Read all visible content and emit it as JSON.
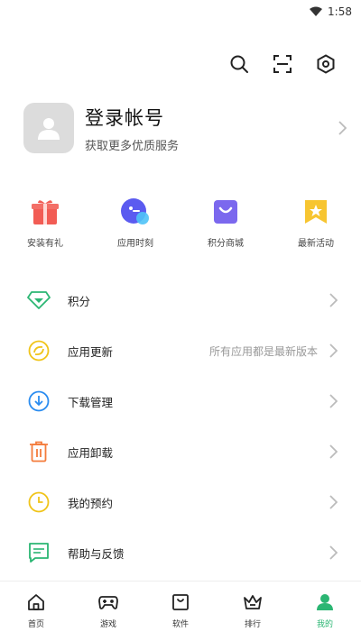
{
  "status": {
    "time": "1:58"
  },
  "top_actions": [
    "search-icon",
    "scan-icon",
    "settings-icon"
  ],
  "profile": {
    "title": "登录帐号",
    "subtitle": "获取更多优质服务"
  },
  "quick_actions": [
    {
      "label": "安装有礼",
      "icon": "gift-icon",
      "color": "#f25c54"
    },
    {
      "label": "应用时刻",
      "icon": "app-moment-icon",
      "color": "#5b5bf0"
    },
    {
      "label": "积分商城",
      "icon": "points-mall-icon",
      "color": "#7b68ee"
    },
    {
      "label": "最新活动",
      "icon": "latest-activity-icon",
      "color": "#f7c531"
    }
  ],
  "menu": [
    {
      "label": "积分",
      "icon": "diamond-icon",
      "color": "#2bb673",
      "hint": ""
    },
    {
      "label": "应用更新",
      "icon": "update-icon",
      "color": "#f0c419",
      "hint": "所有应用都是最新版本"
    },
    {
      "label": "下载管理",
      "icon": "download-icon",
      "color": "#2a8cf0",
      "hint": ""
    },
    {
      "label": "应用卸载",
      "icon": "trash-icon",
      "color": "#f47c3c",
      "hint": ""
    },
    {
      "label": "我的预约",
      "icon": "clock-icon",
      "color": "#f0c419",
      "hint": ""
    },
    {
      "label": "帮助与反馈",
      "icon": "feedback-icon",
      "color": "#2bb673",
      "hint": ""
    }
  ],
  "bottom_nav": [
    {
      "label": "首页",
      "icon": "home-icon"
    },
    {
      "label": "游戏",
      "icon": "gamepad-icon"
    },
    {
      "label": "软件",
      "icon": "software-icon"
    },
    {
      "label": "排行",
      "icon": "ranking-icon"
    },
    {
      "label": "我的",
      "icon": "profile-icon",
      "active": true
    }
  ],
  "colors": {
    "accent": "#2bb673",
    "chevron": "#bbbbbb"
  }
}
